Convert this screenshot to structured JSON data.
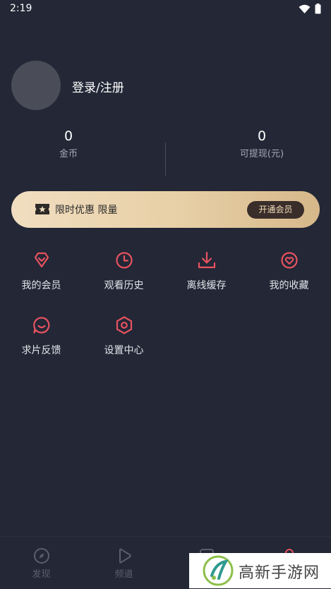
{
  "status_bar": {
    "time": "2:19"
  },
  "profile": {
    "login_text": "登录/注册"
  },
  "stats": [
    {
      "value": "0",
      "label": "金币"
    },
    {
      "value": "0",
      "label": "可提现(元)"
    }
  ],
  "vip_banner": {
    "text": "限时优惠 限量",
    "button_label": "开通会员"
  },
  "menu_items": [
    {
      "label": "我的会员",
      "icon": "diamond-icon"
    },
    {
      "label": "观看历史",
      "icon": "clock-icon"
    },
    {
      "label": "离线缓存",
      "icon": "download-icon"
    },
    {
      "label": "我的收藏",
      "icon": "heart-icon"
    },
    {
      "label": "求片反馈",
      "icon": "chat-bubble-icon"
    },
    {
      "label": "设置中心",
      "icon": "hexagon-settings-icon"
    }
  ],
  "bottom_nav": [
    {
      "label": "发现",
      "icon": "compass-icon"
    },
    {
      "label": "频道",
      "icon": "play-icon"
    },
    {
      "label": "",
      "icon": "square-icon"
    },
    {
      "label": "",
      "icon": "person-icon"
    }
  ],
  "watermark": {
    "text": "高新手游网"
  },
  "colors": {
    "accent": "#e8525f",
    "background": "#232736",
    "gold": "#e7cfa6"
  }
}
